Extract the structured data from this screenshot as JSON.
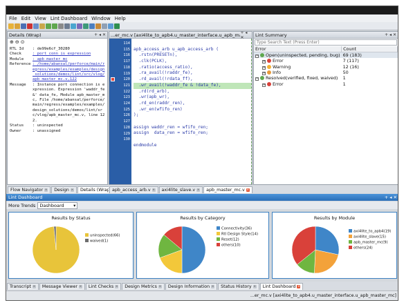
{
  "menu": [
    "File",
    "Edit",
    "View",
    "Lint Dashboard",
    "Window",
    "Help"
  ],
  "details": {
    "header": "Details (Wrap)",
    "rows": [
      {
        "key": "RTL Id",
        "value": ": de99e6cf_30280",
        "link": false
      },
      {
        "key": "Check",
        "value": ": port_conn_is_expression",
        "link": true
      },
      {
        "key": "Module",
        "value": ": apb_master_mc",
        "link": true
      },
      {
        "key": "Reference",
        "value": ": /home/abansal/perforce/main/regress/examples/examples/design_solutions/demos/lint/src/vlog/apb_master_mc.v,122",
        "link": true
      },
      {
        "key": "Message",
        "value": ": Instance port connection is expression. Expression 'waddr_fe&' data_fe, Module apb_master_mc, File /home/abansal/perforce/main/regress/examples/examples/design_solutions/demos/lint/src/vlog/apb_master_mc.v, line 122.",
        "link": false
      },
      {
        "key": "Status",
        "value": ": uninspected",
        "link": false
      },
      {
        "key": "Owner",
        "value": ": unassigned",
        "link": false
      }
    ]
  },
  "editor": {
    "header": "...er_mc.v [axi4lite_to_apb4.u_master_interface.u_apb_master_mc]",
    "lines": [
      {
        "num": "",
        "text": "",
        "mark": false
      },
      {
        "num": "114",
        "text": "apb_access_arb u_apb_access_arb (",
        "mark": false
      },
      {
        "num": "115",
        "text": "  .rstn(PRESETn),",
        "mark": false
      },
      {
        "num": "116",
        "text": "  .clk(PCLK),",
        "mark": false
      },
      {
        "num": "117",
        "text": "  .ratio(access_ratio),",
        "mark": false
      },
      {
        "num": "118",
        "text": "  .ra_avail(!raddr_fe),",
        "mark": false
      },
      {
        "num": "119",
        "text": "  .rd_avail(!rdata_ff),",
        "mark": false
      },
      {
        "num": "120",
        "text": "  .wr_avail(!waddr_fe & !data_fe),",
        "mark": true
      },
      {
        "num": "121",
        "text": "  .rd(rd_arb),",
        "mark": false
      },
      {
        "num": "122",
        "text": "  .wr(apb_wr),",
        "mark": false
      },
      {
        "num": "123",
        "text": "  .rd_en(raddr_ren),",
        "mark": false
      },
      {
        "num": "124",
        "text": "  .wr_en(wfifo_ren)",
        "mark": false
      },
      {
        "num": "125",
        "text": ");",
        "mark": false
      },
      {
        "num": "126",
        "text": "",
        "mark": false
      },
      {
        "num": "127",
        "text": "assign waddr_ren = wfifo_ren;",
        "mark": false
      },
      {
        "num": "128",
        "text": "assign  data_ren = wfifo_ren;",
        "mark": false
      },
      {
        "num": "129",
        "text": "",
        "mark": false
      },
      {
        "num": "130",
        "text": "endmodule",
        "mark": false
      }
    ]
  },
  "lint_summary": {
    "header": "Lint Summary",
    "search_placeholder": "Type Search Text (Press Enter)",
    "col_error": "Error",
    "col_count": "Count",
    "rows": [
      {
        "label": "Open(uninspected, pending, bug)",
        "count": "69 (183)",
        "level": 0,
        "icon": "open",
        "selected": true
      },
      {
        "label": "Error",
        "count": "7 (117)",
        "level": 1,
        "icon": "error",
        "selected": false
      },
      {
        "label": "Warning",
        "count": "12 (16)",
        "level": 1,
        "icon": "warning",
        "selected": false
      },
      {
        "label": "Info",
        "count": "50",
        "level": 1,
        "icon": "info",
        "selected": false
      },
      {
        "label": "Resolved(verified, fixed, waived)",
        "count": "1",
        "level": 0,
        "icon": "resolved",
        "selected": false
      },
      {
        "label": "Error",
        "count": "1",
        "level": 1,
        "icon": "error",
        "selected": false
      }
    ]
  },
  "tabs_left": [
    {
      "label": "Flow Navigator",
      "active": false
    },
    {
      "label": "Design",
      "active": false
    },
    {
      "label": "Details (Wrap)",
      "active": true
    }
  ],
  "tabs_mid": [
    {
      "label": "apb_access_arb.v",
      "active": false
    },
    {
      "label": "axi4lite_slave.v",
      "active": false
    },
    {
      "label": "apb_master_mc.v",
      "active": true
    }
  ],
  "dashboard": {
    "header": "Lint Dashboard",
    "trends_label": "More Trends",
    "trends_value": "Dashboard"
  },
  "bottom_tabs": [
    {
      "label": "Transcript",
      "active": false
    },
    {
      "label": "Message Viewer",
      "active": false
    },
    {
      "label": "Lint Checks",
      "active": false
    },
    {
      "label": "Design Metrics",
      "active": false
    },
    {
      "label": "Design Information",
      "active": false
    },
    {
      "label": "Status History",
      "active": false
    },
    {
      "label": "Lint Dashboard",
      "active": true
    }
  ],
  "status_path": "...er_mc.v [axi4lite_to_apb4.u_master_interface.u_apb_master_mc]",
  "chart_data": [
    {
      "type": "pie",
      "title": "Results by Status",
      "categories": [
        "uninspected(66)",
        "waived(1)"
      ],
      "values": [
        66,
        1
      ],
      "colors": [
        "#e8c43a",
        "#6e6e6e"
      ]
    },
    {
      "type": "pie",
      "title": "Results by Category",
      "categories": [
        "Connectivity(36)",
        "Rtl Design Style(14)",
        "Reset(12)",
        "others(10)"
      ],
      "values": [
        36,
        14,
        12,
        10
      ],
      "colors": [
        "#3f86c8",
        "#f3c83a",
        "#6fb640",
        "#d9413a"
      ]
    },
    {
      "type": "pie",
      "title": "Results by Module",
      "categories": [
        "axi4lite_to_apb4(19)",
        "axi4lite_slave(15)",
        "apb_master_mc(9)",
        "others(24)"
      ],
      "values": [
        19,
        15,
        9,
        24
      ],
      "colors": [
        "#3f86c8",
        "#f3a23a",
        "#6fb640",
        "#d9413a"
      ]
    }
  ]
}
